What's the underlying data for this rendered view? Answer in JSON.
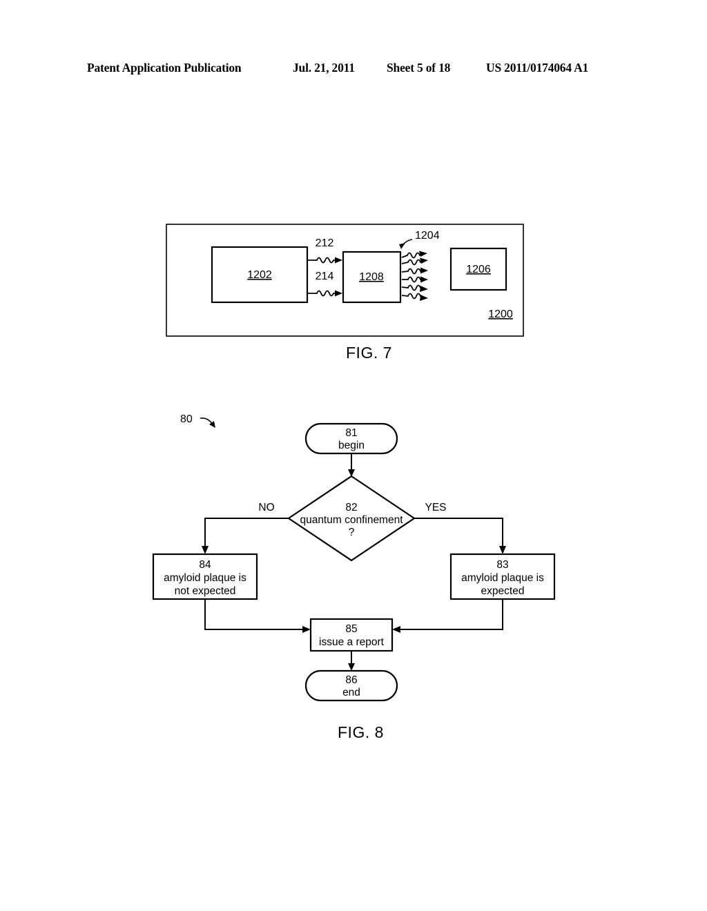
{
  "header": {
    "publication": "Patent Application Publication",
    "date": "Jul. 21, 2011",
    "sheet": "Sheet 5 of 18",
    "publication_number": "US 2011/0174064 A1"
  },
  "figure7": {
    "caption": "FIG. 7",
    "outer_label": "1200",
    "blocks": [
      {
        "id": "block-1202",
        "label": "1202"
      },
      {
        "id": "block-1208",
        "label": "1208"
      },
      {
        "id": "block-1206",
        "label": "1206"
      }
    ],
    "arrow_labels": [
      {
        "id": "arrow-212",
        "label": "212"
      },
      {
        "id": "arrow-214",
        "label": "214"
      }
    ],
    "emission_label": "1204",
    "emission_ray_count": 6
  },
  "figure8": {
    "caption": "FIG. 8",
    "flow_label": "80",
    "nodes": {
      "begin": {
        "number": "81",
        "text": "begin"
      },
      "decision": {
        "number": "82",
        "line1": "quantum confinement",
        "line2": "?"
      },
      "no_branch": {
        "number": "84",
        "line1": "amyloid plaque is",
        "line2": "not expected"
      },
      "yes_branch": {
        "number": "83",
        "line1": "amyloid plaque is",
        "line2": "expected"
      },
      "report": {
        "number": "85",
        "text": "issue a report"
      },
      "end": {
        "number": "86",
        "text": "end"
      }
    },
    "branch_labels": {
      "no": "NO",
      "yes": "YES"
    }
  }
}
